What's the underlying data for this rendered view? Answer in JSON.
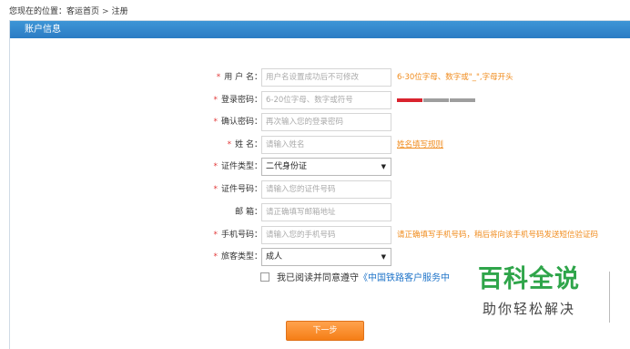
{
  "breadcrumb": {
    "prefix": "您现在的位置：",
    "home": "客运首页",
    "separator": ">",
    "current": "注册"
  },
  "panel": {
    "title": "账户信息"
  },
  "form": {
    "username": {
      "label": "用 户 名：",
      "placeholder": "用户名设置成功后不可修改",
      "hint": "6-30位字母、数字或\"_\",字母开头"
    },
    "password": {
      "label": "登录密码：",
      "placeholder": "6-20位字母、数字或符号"
    },
    "confirm": {
      "label": "确认密码：",
      "placeholder": "再次输入您的登录密码"
    },
    "name": {
      "label": "姓  名：",
      "placeholder": "请输入姓名",
      "hint": "姓名填写规则"
    },
    "id_type": {
      "label": "证件类型：",
      "value": "二代身份证"
    },
    "id_number": {
      "label": "证件号码：",
      "placeholder": "请输入您的证件号码"
    },
    "email": {
      "label": "邮  箱：",
      "placeholder": "请正确填写邮箱地址"
    },
    "phone": {
      "label": "手机号码：",
      "placeholder": "请输入您的手机号码",
      "hint": "请正确填写手机号码，稍后将向该手机号码发送短信验证码"
    },
    "passenger_type": {
      "label": "旅客类型：",
      "value": "成人"
    }
  },
  "password_strength": {
    "level": 1,
    "of": 3,
    "colors": [
      "#d9232e",
      "#9e9e9e",
      "#9e9e9e"
    ]
  },
  "agreement": {
    "text": "我已阅读并同意遵守",
    "link": "《中国铁路客户服务中"
  },
  "next_button": "下一步",
  "watermark": {
    "title": "百科全说",
    "subtitle": "助你轻松解决"
  },
  "colors": {
    "header": "#2b7cc4",
    "accent": "#f57e16",
    "required": "#e23a3a",
    "hint": "#f08c1e",
    "link": "#1f74c9",
    "watermark": "#2fa54a"
  }
}
